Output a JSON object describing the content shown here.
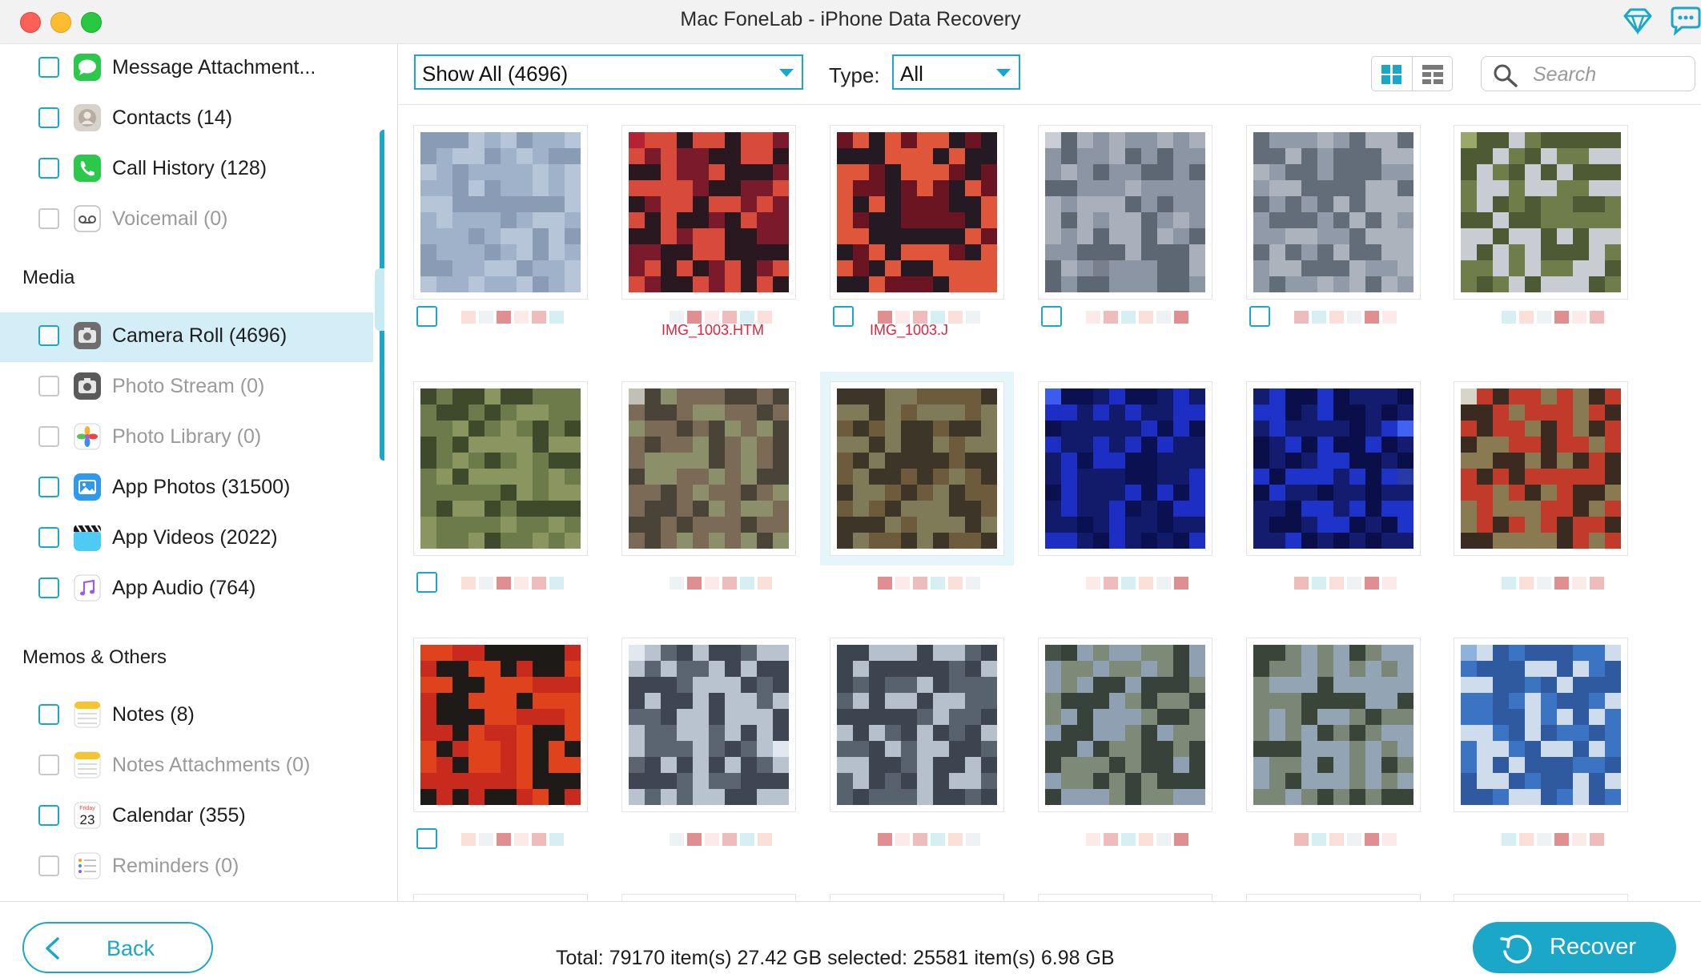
{
  "window": {
    "title": "Mac FoneLab - iPhone Data Recovery"
  },
  "sidebar": {
    "top_items": [
      {
        "label": "Message Attachment...",
        "icon": "message-bubble-icon",
        "enabled": true
      },
      {
        "label": "Contacts (14)",
        "icon": "contacts-icon",
        "enabled": true
      },
      {
        "label": "Call History (128)",
        "icon": "phone-icon",
        "enabled": true
      },
      {
        "label": "Voicemail (0)",
        "icon": "voicemail-icon",
        "enabled": false
      }
    ],
    "media_heading": "Media",
    "media_items": [
      {
        "label": "Camera Roll (4696)",
        "icon": "camera-icon",
        "enabled": true,
        "selected": true
      },
      {
        "label": "Photo Stream (0)",
        "icon": "camera-icon",
        "enabled": false
      },
      {
        "label": "Photo Library (0)",
        "icon": "photos-flower-icon",
        "enabled": false
      },
      {
        "label": "App Photos (31500)",
        "icon": "image-icon",
        "enabled": true
      },
      {
        "label": "App Videos (2022)",
        "icon": "clapperboard-icon",
        "enabled": true
      },
      {
        "label": "App Audio (764)",
        "icon": "music-note-icon",
        "enabled": true
      }
    ],
    "memos_heading": "Memos & Others",
    "memo_items": [
      {
        "label": "Notes (8)",
        "icon": "notes-icon",
        "enabled": true
      },
      {
        "label": "Notes Attachments (0)",
        "icon": "notes-icon",
        "enabled": false
      },
      {
        "label": "Calendar (355)",
        "icon": "calendar-icon",
        "enabled": true,
        "calendar_day": "Friday",
        "calendar_date": "23"
      },
      {
        "label": "Reminders (0)",
        "icon": "reminders-icon",
        "enabled": false
      }
    ]
  },
  "toolbar": {
    "show_filter": "Show All (4696)",
    "type_label": "Type:",
    "type_value": "All",
    "search_placeholder": "Search"
  },
  "thumbnails": {
    "captions": [
      "IMG_1003.HTM",
      "IMG_1003.J"
    ],
    "palettes": [
      [
        "#8a9bb5",
        "#5f7590",
        "#b6c5d8",
        "#3e4d63",
        "#9fb2c9",
        "#6d819b"
      ],
      [
        "#7a1a2a",
        "#b52233",
        "#2a1820",
        "#5b2f6d",
        "#d84a3a",
        "#1d1016"
      ],
      [
        "#6b1523",
        "#c02a36",
        "#241a24",
        "#3c2a8a",
        "#e0563a",
        "#180e14"
      ],
      [
        "#8c95a3",
        "#c9cdd6",
        "#5d6673",
        "#3b4450",
        "#a9b0bb",
        "#77808c"
      ],
      [
        "#909aa8",
        "#cbd0d8",
        "#636c79",
        "#3e4753",
        "#acb3bd",
        "#7a838f"
      ],
      [
        "#6f7d4a",
        "#9aa86a",
        "#4d5a33",
        "#b8c48c",
        "#c9ccd2",
        "#3a4328"
      ],
      [
        "#6d7a4a",
        "#a7b478",
        "#3f4a2c",
        "#c6ccc8",
        "#8a9560",
        "#545a48"
      ],
      [
        "#7b6a55",
        "#a59a84",
        "#4a4438",
        "#c2bfb7",
        "#8b8f6a",
        "#2f2c28"
      ],
      [
        "#6e5b3c",
        "#9c8a62",
        "#3d3628",
        "#c9c3b2",
        "#7f7a58",
        "#2b251c"
      ],
      [
        "#1c2ec4",
        "#2a3aa8",
        "#0b1050",
        "#3c5cf0",
        "#121a6a",
        "#4a6cff"
      ],
      [
        "#1d33c9",
        "#283aa5",
        "#0a0f4a",
        "#4263f2",
        "#141c70",
        "#5270ff"
      ],
      [
        "#3a2a1f",
        "#6b5a3f",
        "#c23a2a",
        "#1f1a15",
        "#8a7a52",
        "#d9d4c8"
      ],
      [
        "#1e1a18",
        "#3c3630",
        "#c92a1e",
        "#5a4a32",
        "#e0421c",
        "#2c2a1e"
      ],
      [
        "#3d4652",
        "#7d8896",
        "#b9c3cf",
        "#262c33",
        "#5b6571",
        "#e2e8ef"
      ],
      [
        "#3b444f",
        "#7a8592",
        "#b6c0cc",
        "#242a31",
        "#58626e",
        "#e6ebf1"
      ],
      [
        "#37433a",
        "#5a6a58",
        "#8fa0b2",
        "#26302a",
        "#7d8a78",
        "#45524a"
      ],
      [
        "#394539",
        "#5c6c5a",
        "#93a4b4",
        "#283128",
        "#7a8776",
        "#475349"
      ],
      [
        "#3c74c4",
        "#8fb2dc",
        "#cfdcec",
        "#5a6a4a",
        "#2f5aa0",
        "#a9c4e4"
      ]
    ]
  },
  "footer": {
    "back_label": "Back",
    "totals": "Total: 79170 item(s) 27.42 GB   selected: 25581 item(s) 6.98 GB",
    "recover_label": "Recover"
  },
  "colors": {
    "accent": "#1aa7c8",
    "selected_row": "#d3eef6"
  }
}
